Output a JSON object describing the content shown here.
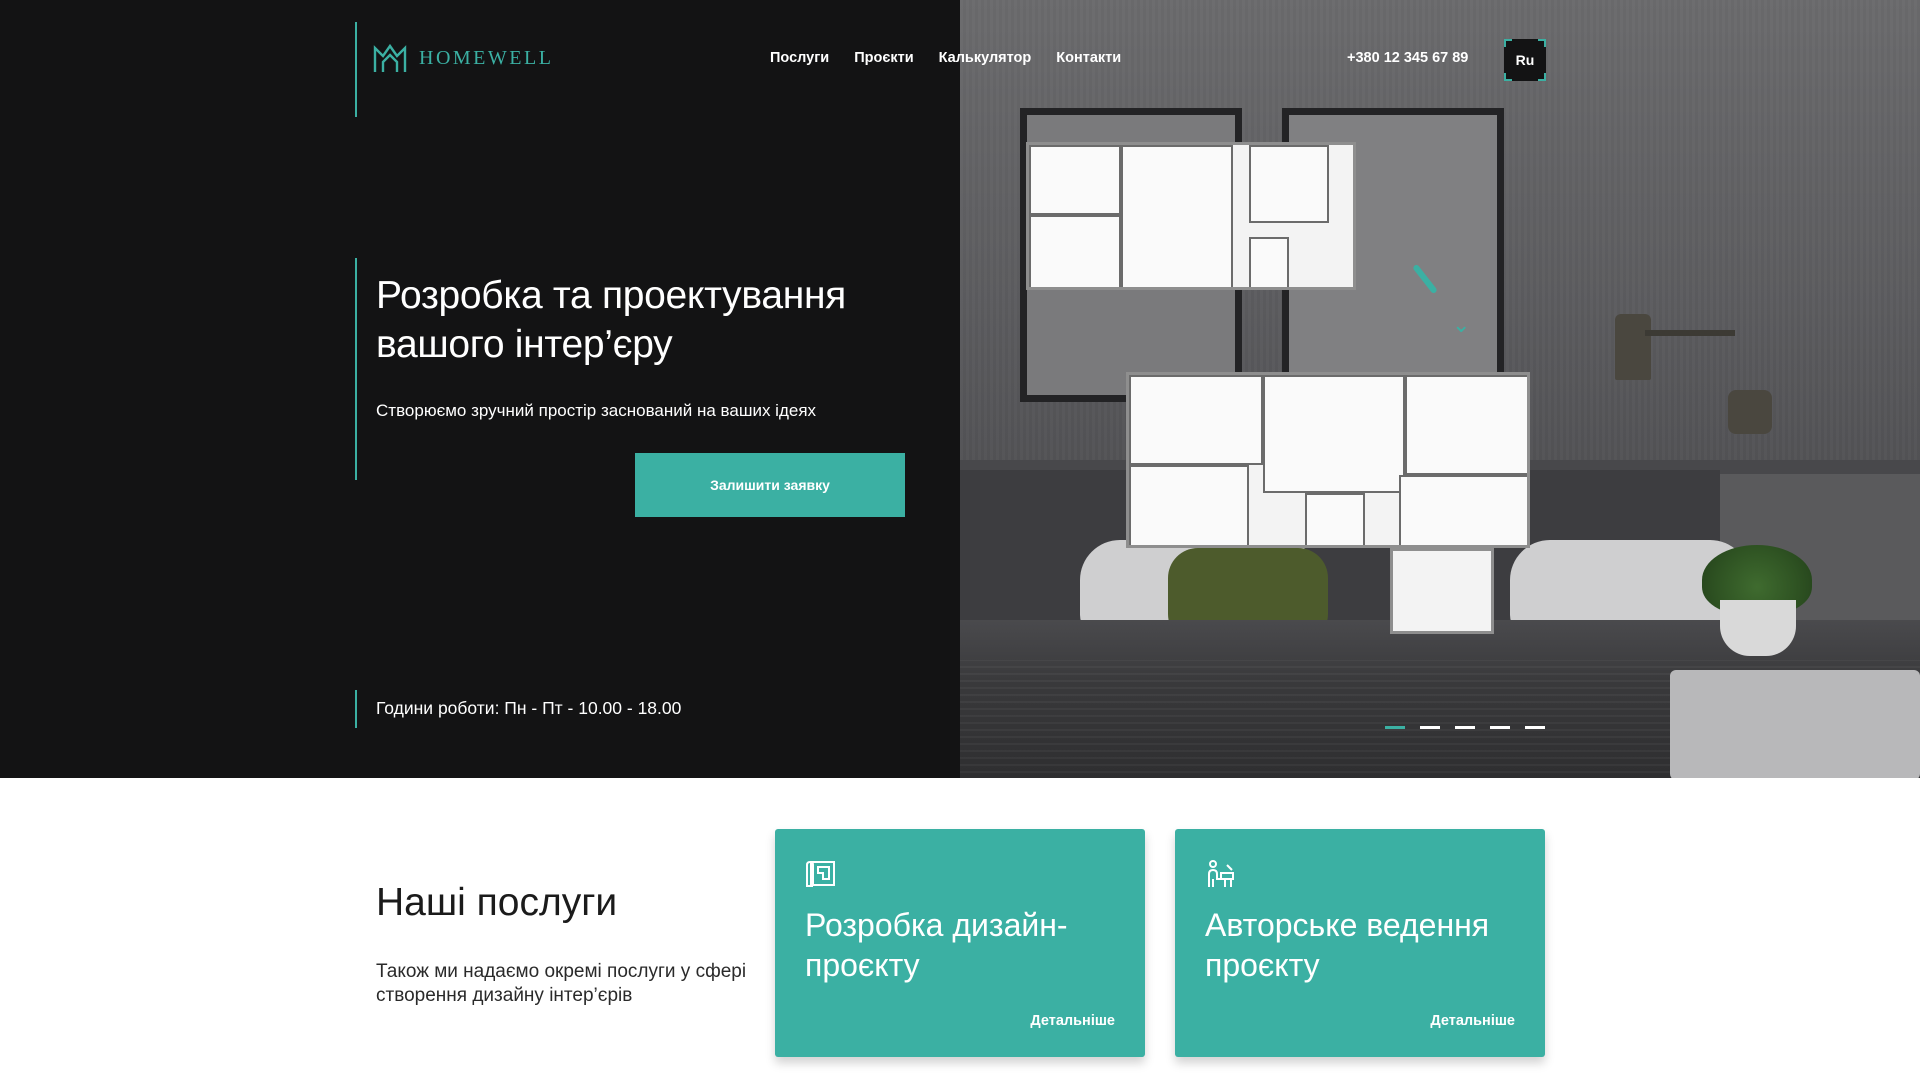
{
  "brand": {
    "name": "HOMEWELL",
    "accent": "#3bb0a3",
    "dark": "#131314"
  },
  "nav": {
    "items": [
      {
        "label": "Послуги"
      },
      {
        "label": "Проєкти"
      },
      {
        "label": "Калькулятор"
      },
      {
        "label": "Контакти"
      }
    ]
  },
  "header": {
    "phone": "+380 12 345 67 89",
    "lang": "Ru"
  },
  "hero": {
    "title": "Розробка та проектування вашого інтер’єру",
    "subtitle": "Створюємо зручний простір заснований на ваших ідеях",
    "cta_label": "Залишити заявку",
    "hours": "Години роботи: Пн - Пт - 10.00 - 18.00",
    "slider": {
      "count": 5,
      "active_index": 0
    }
  },
  "services": {
    "title": "Наші послуги",
    "description": "Також ми надаємо окремі послуги у сфері створення дизайну інтер’єрів",
    "cards": [
      {
        "icon": "blueprint-icon",
        "title": "Розробка дизайн-проєкту",
        "more_label": "Детальніше"
      },
      {
        "icon": "designer-icon",
        "title": "Авторське ведення проєкту",
        "more_label": "Детальніше"
      }
    ]
  }
}
